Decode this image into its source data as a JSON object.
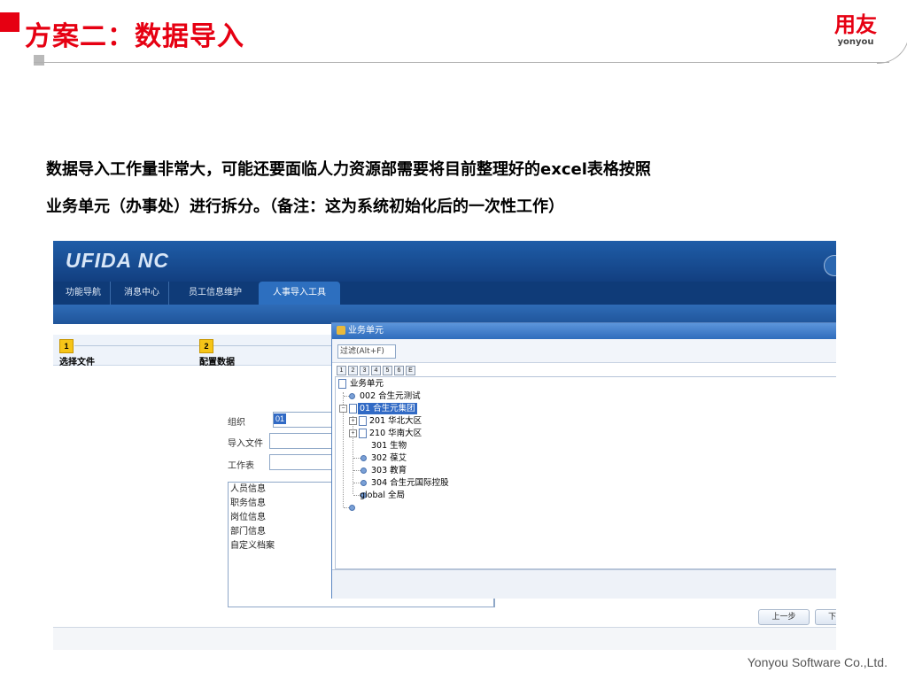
{
  "slide": {
    "title": "方案二：数据导入",
    "logo_cn": "用友",
    "logo_en": "yonyou",
    "body_line1": "数据导入工作量非常大，可能还要面临人力资源部需要将目前整理好的excel表格按照",
    "body_line2": "业务单元（办事处）进行拆分。（备注：这为系统初始化后的一次性工作）",
    "footer": "Yonyou Software Co.,Ltd."
  },
  "app": {
    "logo": "UFIDA NC",
    "tabs": [
      {
        "label": "功能导航",
        "active": false
      },
      {
        "label": "消息中心",
        "active": false
      },
      {
        "label": "员工信息维护",
        "active": false
      },
      {
        "label": "人事导入工具",
        "active": true
      }
    ],
    "steps": [
      {
        "num": "1",
        "label": "选择文件"
      },
      {
        "num": "2",
        "label": "配置数据"
      }
    ],
    "form": {
      "org_label": "组织",
      "org_value": "01",
      "file_label": "导入文件",
      "sheet_label": "工作表"
    },
    "sheets": [
      "人员信息",
      "职务信息",
      "岗位信息",
      "部门信息",
      "自定义档案"
    ],
    "buttons": {
      "prev": "上一步",
      "next": "下"
    }
  },
  "dialog": {
    "title": "业务单元",
    "filter_placeholder": "过滤(Alt+F)",
    "levels": [
      "1",
      "2",
      "3",
      "4",
      "5",
      "6",
      "E"
    ],
    "tree": {
      "root": "业务单元",
      "n1": "002 合生元测试",
      "n2": "01 合生元集团",
      "n2_1": "201 华北大区",
      "n2_2": "210 华南大区",
      "n2_3": "301 生物",
      "n2_4": "302 葆艾",
      "n2_5": "303 教育",
      "n2_6": "304 合生元国际控股",
      "n3": "global 全局"
    }
  },
  "colors": {
    "brand_red": "#e60012",
    "app_blue": "#1f5da8",
    "selection_blue": "#316ac5"
  }
}
